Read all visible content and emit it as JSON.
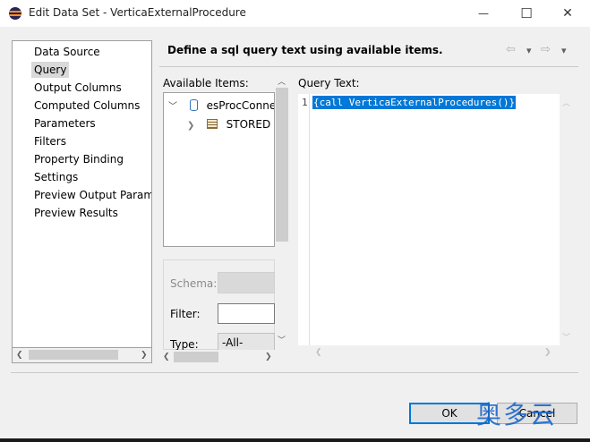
{
  "window": {
    "title": "Edit Data Set - VerticaExternalProcedure",
    "controls": {
      "minimize": "—",
      "maximize": "☐",
      "close": "✕"
    }
  },
  "nav": {
    "items": [
      {
        "label": "Data Source",
        "selected": false
      },
      {
        "label": "Query",
        "selected": true
      },
      {
        "label": "Output Columns",
        "selected": false
      },
      {
        "label": "Computed Columns",
        "selected": false
      },
      {
        "label": "Parameters",
        "selected": false
      },
      {
        "label": "Filters",
        "selected": false
      },
      {
        "label": "Property Binding",
        "selected": false
      },
      {
        "label": "Settings",
        "selected": false
      },
      {
        "label": "Preview Output Parameters",
        "selected": false
      },
      {
        "label": "Preview Results",
        "selected": false
      }
    ]
  },
  "header": {
    "title": "Define a sql query text using available items.",
    "back_icon": "⇦",
    "forward_icon": "⇨",
    "dropdown_icon": "▾"
  },
  "available": {
    "label": "Available Items:",
    "tree": {
      "root": "esProcConnection",
      "child": "STORED PROCEDURES"
    }
  },
  "filter": {
    "schema_label": "Schema:",
    "filter_label": "Filter:",
    "filter_value": "",
    "type_label": "Type:",
    "type_value": "-All-"
  },
  "query": {
    "label": "Query Text:",
    "line_number": "1",
    "text": "{call VerticaExternalProcedures()}"
  },
  "buttons": {
    "ok": "OK",
    "cancel": "Cancel"
  },
  "watermark": "奥多云"
}
